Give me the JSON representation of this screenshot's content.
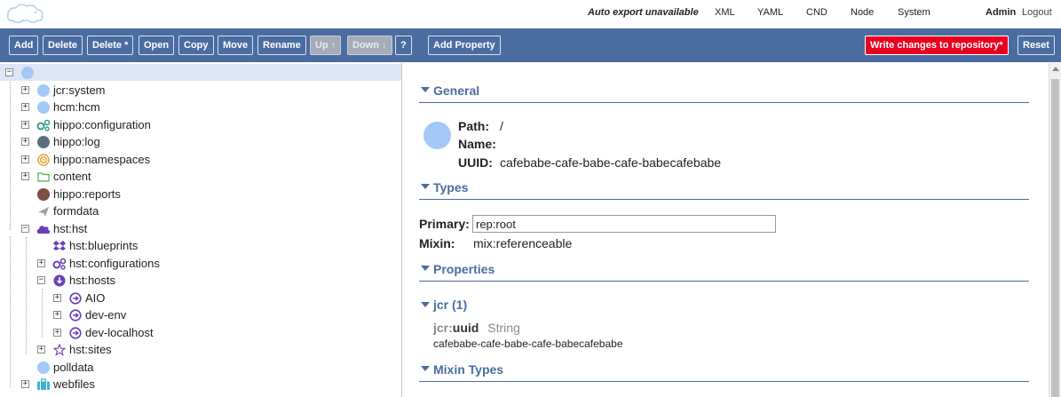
{
  "topnav": {
    "auto_export": "Auto export unavailable",
    "xml": "XML",
    "yaml": "YAML",
    "cnd": "CND",
    "node": "Node",
    "system": "System",
    "user": "Admin",
    "logout": "Logout"
  },
  "toolbar": {
    "add": "Add",
    "delete": "Delete",
    "delete_star": "Delete *",
    "open": "Open",
    "copy": "Copy",
    "move": "Move",
    "rename": "Rename",
    "up": "Up ↑",
    "down": "Down ↓",
    "help": "?",
    "add_property": "Add Property",
    "write_changes": "Write changes to repository*",
    "reset": "Reset"
  },
  "tree": {
    "items": [
      {
        "label": "",
        "icon": "root-circle-icon",
        "expander": "−"
      },
      {
        "label": "jcr:system",
        "icon": "circle-icon",
        "expander": "+"
      },
      {
        "label": "hcm:hcm",
        "icon": "circle-icon",
        "expander": "+"
      },
      {
        "label": "hippo:configuration",
        "icon": "gears-icon",
        "expander": "+"
      },
      {
        "label": "hippo:log",
        "icon": "circle-icon",
        "expander": "+"
      },
      {
        "label": "hippo:namespaces",
        "icon": "target-icon",
        "expander": "+"
      },
      {
        "label": "content",
        "icon": "folder-icon",
        "expander": "+"
      },
      {
        "label": "hippo:reports",
        "icon": "circle-icon",
        "expander": ""
      },
      {
        "label": "formdata",
        "icon": "paper-plane-icon",
        "expander": ""
      },
      {
        "label": "hst:hst",
        "icon": "cloud-icon",
        "expander": "−"
      },
      {
        "label": "hst:blueprints",
        "icon": "dropbox-icon",
        "expander": ""
      },
      {
        "label": "hst:configurations",
        "icon": "gears-icon",
        "expander": "+"
      },
      {
        "label": "hst:hosts",
        "icon": "download-icon",
        "expander": "−"
      },
      {
        "label": "AIO",
        "icon": "arrow-circle-icon",
        "expander": "+"
      },
      {
        "label": "dev-env",
        "icon": "arrow-circle-icon",
        "expander": "+"
      },
      {
        "label": "dev-localhost",
        "icon": "arrow-circle-icon",
        "expander": "+"
      },
      {
        "label": "hst:sites",
        "icon": "star-icon",
        "expander": "+"
      },
      {
        "label": "polldata",
        "icon": "circle-icon",
        "expander": ""
      },
      {
        "label": "webfiles",
        "icon": "briefcase-icon",
        "expander": "+"
      }
    ]
  },
  "detail": {
    "general_title": "General",
    "path_label": "Path:",
    "path_value": "/",
    "name_label": "Name:",
    "name_value": "",
    "uuid_label": "UUID:",
    "uuid_value": "cafebabe-cafe-babe-cafe-babecafebabe",
    "types_title": "Types",
    "primary_label": "Primary:",
    "primary_value": "rep:root",
    "mixin_label": "Mixin:",
    "mixin_value": "mix:referenceable",
    "properties_title": "Properties",
    "jcr_group": "jcr (1)",
    "prop_prefix": "jcr:",
    "prop_name": "uuid",
    "prop_type": "String",
    "prop_value": "cafebabe-cafe-babe-cafe-babecafebabe",
    "mixin_types_title": "Mixin Types"
  },
  "colors": {
    "toolbar": "#4b6ca1",
    "danger": "#e8001f",
    "selection": "#dde6f6",
    "node_circle": "#a3c8f5",
    "hst_purple": "#6a3fb5"
  }
}
